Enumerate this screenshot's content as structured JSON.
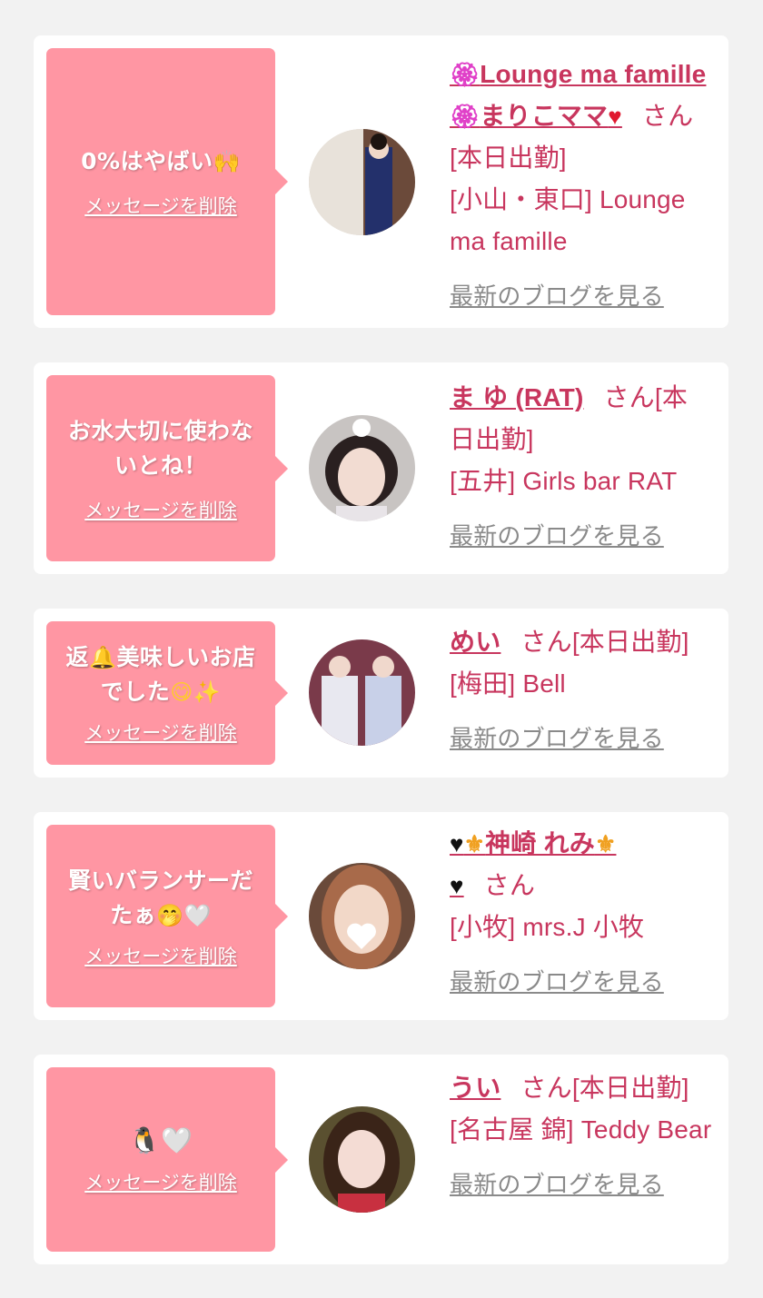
{
  "delete_label": "メッセージを削除",
  "blog_label": "最新のブログを見る",
  "san_label": "さん",
  "entries": [
    {
      "message": "0%はやばい",
      "message_emoji": "🙌",
      "name_prefix_icon": "🏵",
      "name_line1": "Lounge ma famille",
      "name_line2_icon": "🏵",
      "name_line2": "まりこママ",
      "name_suffix_icon": "♥",
      "status": "[本日出勤]",
      "location": "[小山・東口] Lounge ma famille"
    },
    {
      "message": "お水大切に使わないとね！",
      "name": "ま ゆ (RAT)",
      "status": "[本日出勤]",
      "location": "[五井] Girls bar RAT"
    },
    {
      "message": "返",
      "message_emoji1": "🔔",
      "message_rest": "美味しいお店でした",
      "message_emoji2": "😋✨",
      "name": "めい",
      "status": "[本日出勤]",
      "location": "[梅田] Bell"
    },
    {
      "message": "賢いバランサーだたぁ",
      "message_emoji": "🤭🤍",
      "name_icon1": "♥",
      "name_icon2": "⚜",
      "name": "神崎 れみ",
      "name_icon3": "⚜",
      "name_icon4": "♥",
      "location": "[小牧] mrs.J 小牧"
    },
    {
      "message_emoji": "🐧🤍",
      "name": "うい",
      "status": "[本日出勤]",
      "location": "[名古屋 錦] Teddy Bear"
    }
  ]
}
